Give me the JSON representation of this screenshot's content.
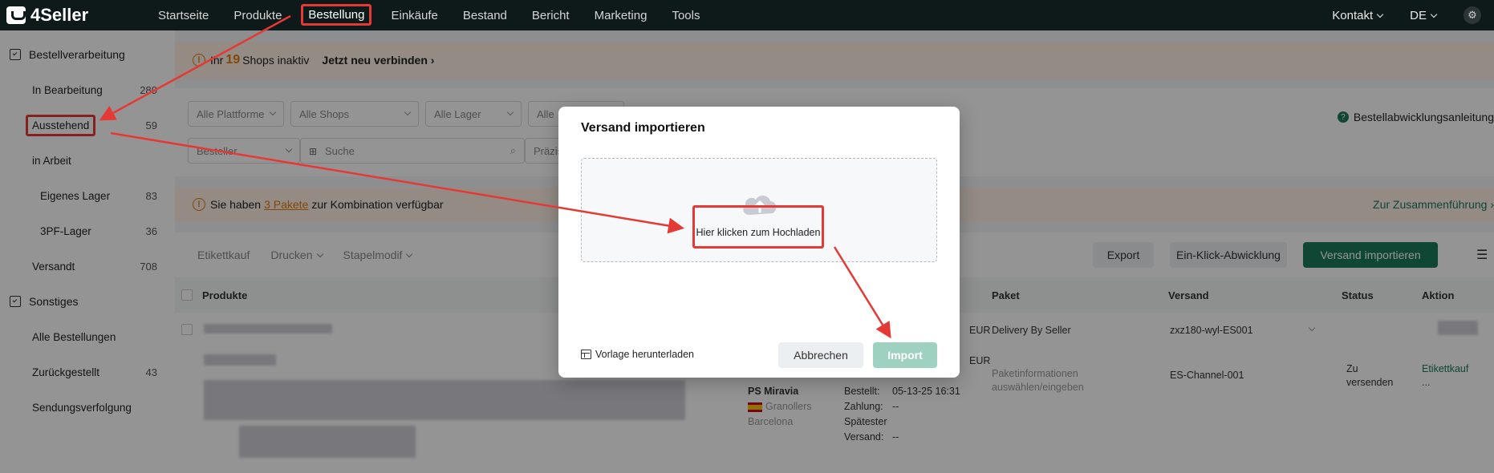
{
  "app": {
    "logo": "4Seller"
  },
  "nav": {
    "items": [
      "Startseite",
      "Produkte",
      "Bestellung",
      "Einkäufe",
      "Bestand",
      "Bericht",
      "Marketing",
      "Tools"
    ],
    "active_index": 2,
    "contact": "Kontakt",
    "language": "DE"
  },
  "sidebar": {
    "group_orders": "Bestellverarbeitung",
    "items": [
      {
        "label": "In Bearbeitung",
        "count": "289"
      },
      {
        "label": "Ausstehend",
        "count": "59"
      },
      {
        "label": "in Arbeit",
        "count": ""
      },
      {
        "label": "Eigenes Lager",
        "count": "83"
      },
      {
        "label": "3PF-Lager",
        "count": "36"
      },
      {
        "label": "Versandt",
        "count": "708"
      }
    ],
    "group_other": "Sonstiges",
    "other_items": [
      {
        "label": "Alle Bestellungen",
        "count": ""
      },
      {
        "label": "Zurückgestellt",
        "count": "43"
      },
      {
        "label": "Sendungsverfolgung",
        "count": ""
      }
    ]
  },
  "banner": {
    "prefix": "Ihr",
    "count": "19",
    "suffix": "Shops inaktiv",
    "reconnect": "Jetzt neu verbinden"
  },
  "filters": {
    "platform": "Alle Plattforme",
    "shops": "Alle Shops",
    "warehouse": "Alle Lager",
    "fourth": "Alle",
    "buyer": "Besteller",
    "search_placeholder": "Suche",
    "precise": "Präzis",
    "help": "Bestellabwicklungsanleitung"
  },
  "combo": {
    "prefix": "Sie haben",
    "link": "3 Pakete",
    "suffix": "zur Kombination verfügbar",
    "merge": "Zur Zusammenführung"
  },
  "toolbar": {
    "label_buy": "Etikettkauf",
    "print": "Drucken",
    "batch": "Stapelmodif",
    "export": "Export",
    "one_click": "Ein-Klick-Abwicklung",
    "import_shipping": "Versand importieren"
  },
  "table": {
    "headers": {
      "products": "Produkte",
      "package": "Paket",
      "shipping": "Versand",
      "status": "Status",
      "action": "Aktion"
    },
    "row1": {
      "currency": "EUR",
      "package": "Delivery By Seller",
      "shipping": "zxz180-wyl-ES001"
    },
    "row2": {
      "currency": "EUR",
      "shop": "PS Miravia",
      "city": "Granollers",
      "region": "Barcelona",
      "ordered_label": "Bestellt:",
      "ordered_value": "05-13-25 16:31",
      "payment_label": "Zahlung:",
      "payment_value": "--",
      "latest_label": "Spätester",
      "ship_label": "Versand:",
      "ship_value": "--",
      "package_hint_1": "Paketinformationen",
      "package_hint_2": "auswählen/eingeben",
      "shipping": "ES-Channel-001",
      "status_1": "Zu",
      "status_2": "versenden",
      "action": "Etikettkauf",
      "action_more": "..."
    }
  },
  "modal": {
    "title": "Versand importieren",
    "upload": "Hier klicken zum Hochladen",
    "template": "Vorlage herunterladen",
    "cancel": "Abbrechen",
    "import": "Import"
  },
  "colors": {
    "accent": "#1a7a5a",
    "annotation": "#e53935",
    "warning": "#e07a10"
  }
}
